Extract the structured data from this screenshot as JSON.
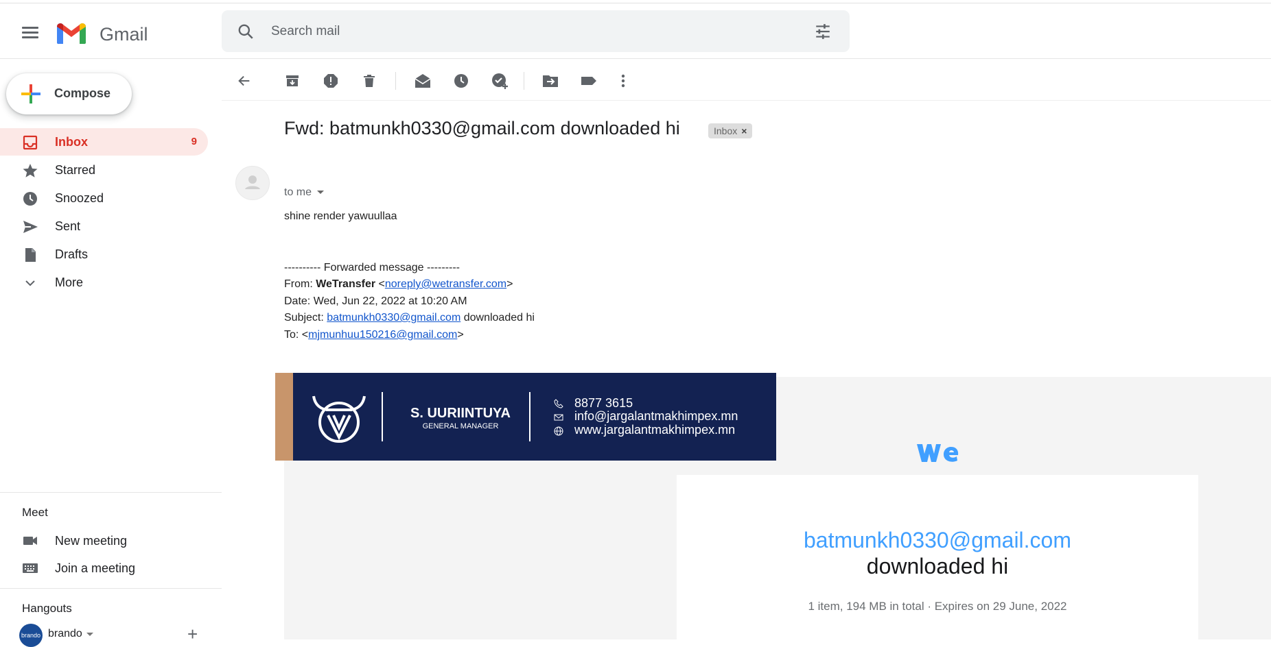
{
  "app": {
    "name": "Gmail"
  },
  "search": {
    "placeholder": "Search mail"
  },
  "compose": {
    "label": "Compose"
  },
  "sidebar": {
    "items": [
      {
        "label": "Inbox",
        "count": "9",
        "icon": "inbox-icon"
      },
      {
        "label": "Starred",
        "icon": "star-icon"
      },
      {
        "label": "Snoozed",
        "icon": "clock-icon"
      },
      {
        "label": "Sent",
        "icon": "send-icon"
      },
      {
        "label": "Drafts",
        "icon": "draft-icon"
      },
      {
        "label": "More",
        "icon": "chevron-down-icon"
      }
    ]
  },
  "meet": {
    "title": "Meet",
    "items": [
      {
        "label": "New meeting",
        "icon": "video-icon"
      },
      {
        "label": "Join a meeting",
        "icon": "keyboard-icon"
      }
    ]
  },
  "hangouts": {
    "title": "Hangouts",
    "user": {
      "name": "brando",
      "avatar_text": "brando"
    }
  },
  "toolbar": {
    "icons": [
      "back-icon",
      "archive-icon",
      "report-spam-icon",
      "delete-icon",
      "mark-unread-icon",
      "snooze-icon",
      "add-task-icon",
      "move-to-icon",
      "label-icon",
      "more-vert-icon"
    ]
  },
  "message": {
    "subject": "Fwd: batmunkh0330@gmail.com downloaded hi",
    "label_chip": "Inbox",
    "recipient": "to me",
    "body_line": "shine render yawuullaa",
    "forwarded_header": "---------- Forwarded message ---------",
    "from_label": "From: ",
    "from_name": "WeTransfer",
    "from_email": "noreply@wetransfer.com",
    "date_line": "Date: Wed, Jun 22, 2022 at 10:20 AM",
    "subject_label": "Subject: ",
    "subject_link": "batmunkh0330@gmail.com",
    "subject_rest": " downloaded hi",
    "to_label": "To: <",
    "to_email": "mjmunhuu150216@gmail.com",
    "to_close": ">"
  },
  "signature": {
    "name": "S. UURIINTUYA",
    "role": "GENERAL MANAGER",
    "phone": "8877 3615",
    "email": "info@jargalantmakhimpex.mn",
    "website": "www.jargalantmakhimpex.mn",
    "colors": {
      "band": "#132252",
      "accent": "#c8956b"
    }
  },
  "wetransfer": {
    "email": "batmunkh0330@gmail.com",
    "downloaded": "downloaded hi",
    "info": "1 item, 194 MB in total  ·  Expires on 29 June, 2022",
    "colors": {
      "link": "#409fff",
      "logo": "#409fff"
    }
  }
}
